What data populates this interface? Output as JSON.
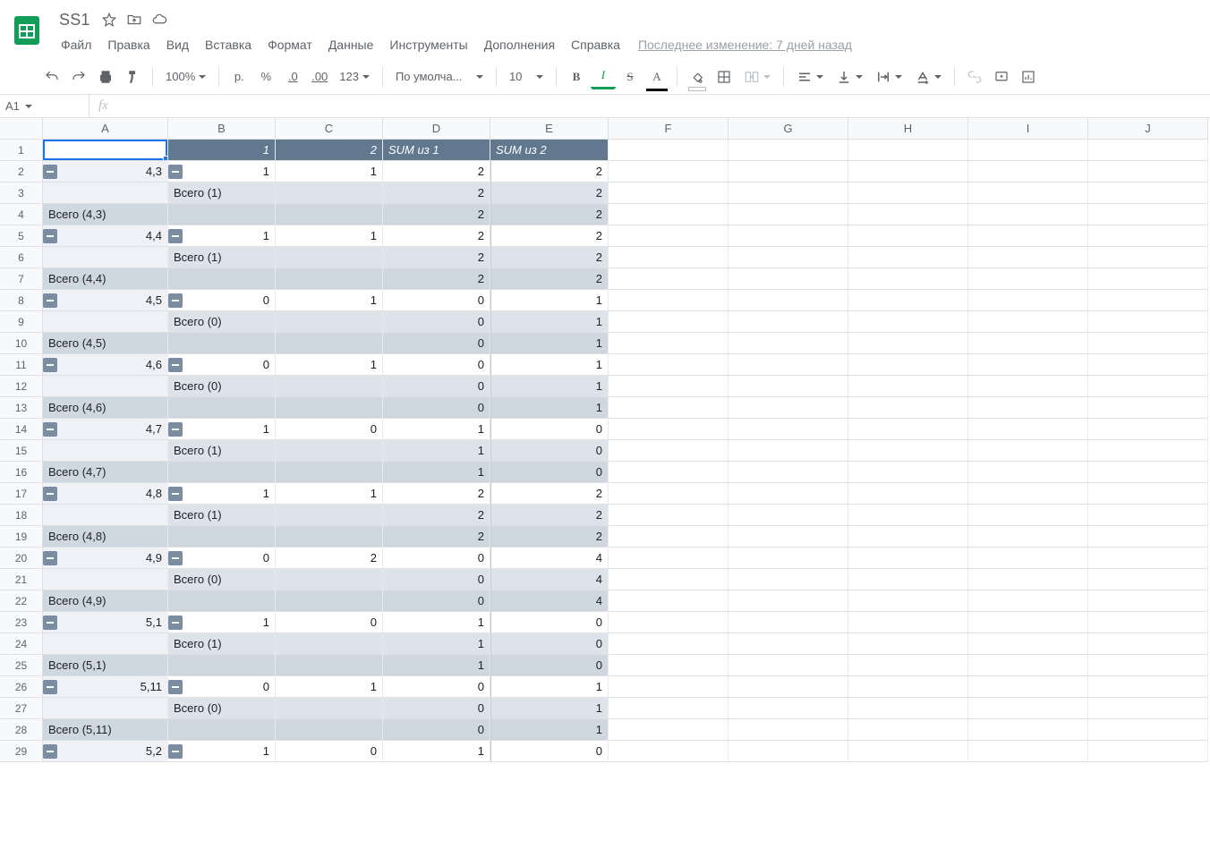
{
  "doc": {
    "title": "SS1",
    "last_edit": "Последнее изменение: 7 дней назад"
  },
  "menus": [
    "Файл",
    "Правка",
    "Вид",
    "Вставка",
    "Формат",
    "Данные",
    "Инструменты",
    "Дополнения",
    "Справка"
  ],
  "toolbar": {
    "zoom": "100%",
    "currency": "р.",
    "percent": "%",
    "dec_dec": ".0",
    "dec_inc": ".00",
    "numfmt": "123",
    "font": "По умолча...",
    "font_size": "10",
    "bold": "B",
    "italic": "I",
    "strike": "S",
    "color": "A"
  },
  "namebox": "A1",
  "columns": [
    "A",
    "B",
    "C",
    "D",
    "E",
    "F",
    "G",
    "H",
    "I",
    "J"
  ],
  "header_row": {
    "b": "1",
    "c": "2",
    "d": "SUM из 1",
    "e": "SUM из 2"
  },
  "rows": [
    {
      "n": 2,
      "t": "data",
      "a": "4,3",
      "b": "1",
      "c": "1",
      "d": "2",
      "e": "2"
    },
    {
      "n": 3,
      "t": "subtot",
      "b": "Всего (1)",
      "d": "2",
      "e": "2"
    },
    {
      "n": 4,
      "t": "tot",
      "a": "Всего (4,3)",
      "d": "2",
      "e": "2"
    },
    {
      "n": 5,
      "t": "data",
      "a": "4,4",
      "b": "1",
      "c": "1",
      "d": "2",
      "e": "2"
    },
    {
      "n": 6,
      "t": "subtot",
      "b": "Всего (1)",
      "d": "2",
      "e": "2"
    },
    {
      "n": 7,
      "t": "tot",
      "a": "Всего (4,4)",
      "d": "2",
      "e": "2"
    },
    {
      "n": 8,
      "t": "data",
      "a": "4,5",
      "b": "0",
      "c": "1",
      "d": "0",
      "e": "1"
    },
    {
      "n": 9,
      "t": "subtot",
      "b": "Всего (0)",
      "d": "0",
      "e": "1"
    },
    {
      "n": 10,
      "t": "tot",
      "a": "Всего (4,5)",
      "d": "0",
      "e": "1"
    },
    {
      "n": 11,
      "t": "data",
      "a": "4,6",
      "b": "0",
      "c": "1",
      "d": "0",
      "e": "1"
    },
    {
      "n": 12,
      "t": "subtot",
      "b": "Всего (0)",
      "d": "0",
      "e": "1"
    },
    {
      "n": 13,
      "t": "tot",
      "a": "Всего (4,6)",
      "d": "0",
      "e": "1"
    },
    {
      "n": 14,
      "t": "data",
      "a": "4,7",
      "b": "1",
      "c": "0",
      "d": "1",
      "e": "0"
    },
    {
      "n": 15,
      "t": "subtot",
      "b": "Всего (1)",
      "d": "1",
      "e": "0"
    },
    {
      "n": 16,
      "t": "tot",
      "a": "Всего (4,7)",
      "d": "1",
      "e": "0"
    },
    {
      "n": 17,
      "t": "data",
      "a": "4,8",
      "b": "1",
      "c": "1",
      "d": "2",
      "e": "2"
    },
    {
      "n": 18,
      "t": "subtot",
      "b": "Всего (1)",
      "d": "2",
      "e": "2"
    },
    {
      "n": 19,
      "t": "tot",
      "a": "Всего (4,8)",
      "d": "2",
      "e": "2"
    },
    {
      "n": 20,
      "t": "data",
      "a": "4,9",
      "b": "0",
      "c": "2",
      "d": "0",
      "e": "4"
    },
    {
      "n": 21,
      "t": "subtot",
      "b": "Всего (0)",
      "d": "0",
      "e": "4"
    },
    {
      "n": 22,
      "t": "tot",
      "a": "Всего (4,9)",
      "d": "0",
      "e": "4"
    },
    {
      "n": 23,
      "t": "data",
      "a": "5,1",
      "b": "1",
      "c": "0",
      "d": "1",
      "e": "0"
    },
    {
      "n": 24,
      "t": "subtot",
      "b": "Всего (1)",
      "d": "1",
      "e": "0"
    },
    {
      "n": 25,
      "t": "tot",
      "a": "Всего (5,1)",
      "d": "1",
      "e": "0"
    },
    {
      "n": 26,
      "t": "data",
      "a": "5,11",
      "b": "0",
      "c": "1",
      "d": "0",
      "e": "1"
    },
    {
      "n": 27,
      "t": "subtot",
      "b": "Всего (0)",
      "d": "0",
      "e": "1"
    },
    {
      "n": 28,
      "t": "tot",
      "a": "Всего (5,11)",
      "d": "0",
      "e": "1"
    },
    {
      "n": 29,
      "t": "data",
      "a": "5,2",
      "b": "1",
      "c": "0",
      "d": "1",
      "e": "0"
    }
  ]
}
